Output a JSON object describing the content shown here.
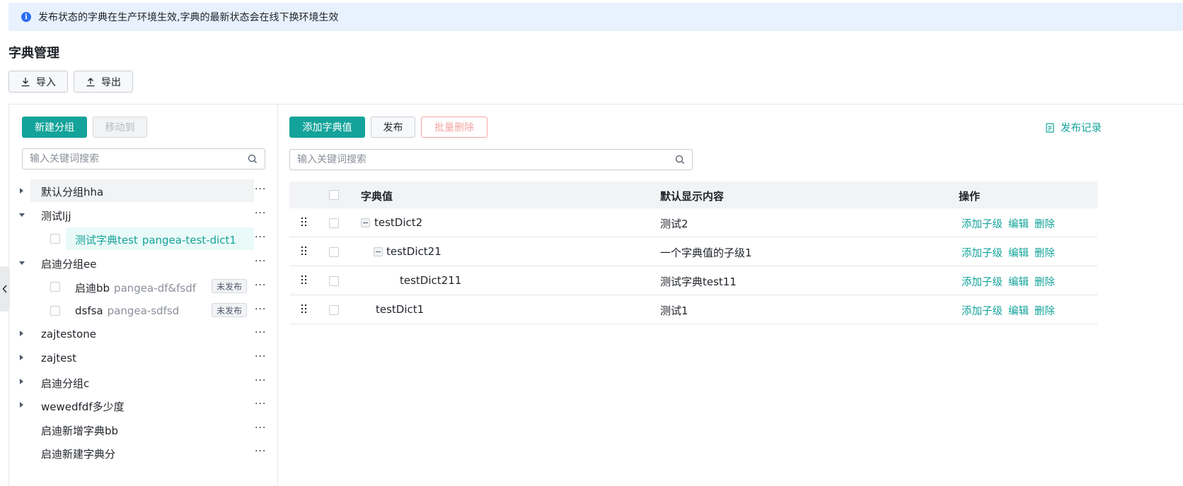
{
  "notice": {
    "text": "发布状态的字典在生产环境生效,字典的最新状态会在线下换环境生效"
  },
  "page_title": "字典管理",
  "toolbar": {
    "import_label": "导入",
    "export_label": "导出"
  },
  "left": {
    "new_group_label": "新建分组",
    "move_to_label": "移动到",
    "search_placeholder": "输入关键词搜索",
    "tree": [
      {
        "label": "默认分组hha",
        "expanded": false
      },
      {
        "label": "测试ljj",
        "expanded": true
      },
      {
        "label": "测试字典test",
        "key": "pangea-test-dict1",
        "child": true,
        "selected": true
      },
      {
        "label": "启迪分组ee",
        "expanded": true
      },
      {
        "label": "启迪bb",
        "key": "pangea-df&fsdf",
        "child": true,
        "badge": "未发布"
      },
      {
        "label": "dsfsa",
        "key": "pangea-sdfsd",
        "child": true,
        "badge": "未发布"
      },
      {
        "label": "zajtestone",
        "expanded": false
      },
      {
        "label": "zajtest",
        "expanded": false
      },
      {
        "label": "启迪分组c",
        "expanded": false
      },
      {
        "label": "wewedfdf多少度",
        "expanded": false
      },
      {
        "label": "启迪新增字典bb"
      },
      {
        "label": "启迪新建字典分"
      }
    ],
    "more_symbol": "···"
  },
  "right": {
    "add_value_label": "添加字典值",
    "publish_label": "发布",
    "batch_delete_label": "批量删除",
    "publish_log_label": "发布记录",
    "search_placeholder": "输入关键词搜索",
    "columns": {
      "value": "字典值",
      "display": "默认显示内容",
      "ops": "操作"
    },
    "rows": [
      {
        "value": "testDict2",
        "display": "测试2",
        "level": 0,
        "expandable": true
      },
      {
        "value": "testDict21",
        "display": "一个字典值的子级1",
        "level": 1,
        "expandable": true
      },
      {
        "value": "testDict211",
        "display": "测试字典test11",
        "level": 2,
        "expandable": false
      },
      {
        "value": "testDict1",
        "display": "测试1",
        "level": 0,
        "expandable": false
      }
    ],
    "ops": {
      "add_child": "添加子级",
      "edit": "编辑",
      "delete": "删除"
    }
  },
  "colors": {
    "accent": "#14a39a",
    "info_bg": "#e8f1fe",
    "info_icon": "#2b6ef5",
    "danger_disabled": "#f3a4a2"
  },
  "icons": [
    "info-icon",
    "download-icon",
    "upload-icon",
    "search-icon",
    "caret-right-icon",
    "caret-down-icon",
    "more-icon",
    "document-icon",
    "drag-handle-icon",
    "collapse-icon",
    "chevron-left-icon"
  ]
}
